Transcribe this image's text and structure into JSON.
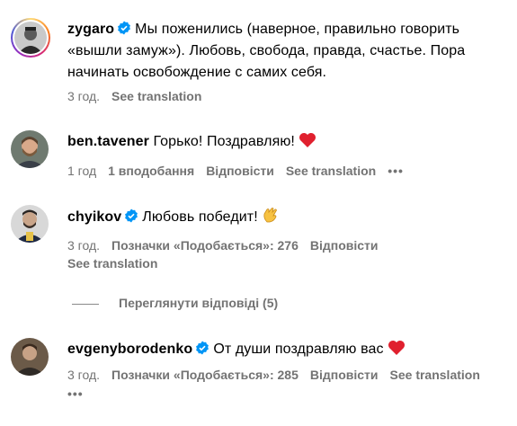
{
  "comments": [
    {
      "username": "zygaro",
      "verified": true,
      "text": "Мы поженились (наверное, правильно говорить «вышли замуж»). Любовь, свобода, правда, счастье. Пора начинать освобождение с самих себя.",
      "time": "3 год.",
      "see_translation": "See translation"
    },
    {
      "username": "ben.tavener",
      "verified": false,
      "text": "Горько! Поздравляю!",
      "emoji": "red-heart",
      "time": "1 год",
      "likes": "1 вподобання",
      "reply": "Відповісти",
      "see_translation": "See translation",
      "more": "•••"
    },
    {
      "username": "chyikov",
      "verified": true,
      "text": "Любовь победит!",
      "emoji": "clapping-hands",
      "time": "3 год.",
      "likes": "Позначки «Подобається»: 276",
      "reply": "Відповісти",
      "see_translation": "See translation"
    },
    {
      "username": "evgenyborodenko",
      "verified": true,
      "text": "От души поздравляю вас",
      "emoji": "red-heart",
      "time": "3 год.",
      "likes": "Позначки «Подобається»: 285",
      "reply": "Відповісти",
      "see_translation": "See translation",
      "more": "•••"
    }
  ],
  "view_replies": "Переглянути відповіді (5)",
  "colors": {
    "verified": "#0095f6",
    "meta": "#737373",
    "heart": "#ff3040"
  }
}
